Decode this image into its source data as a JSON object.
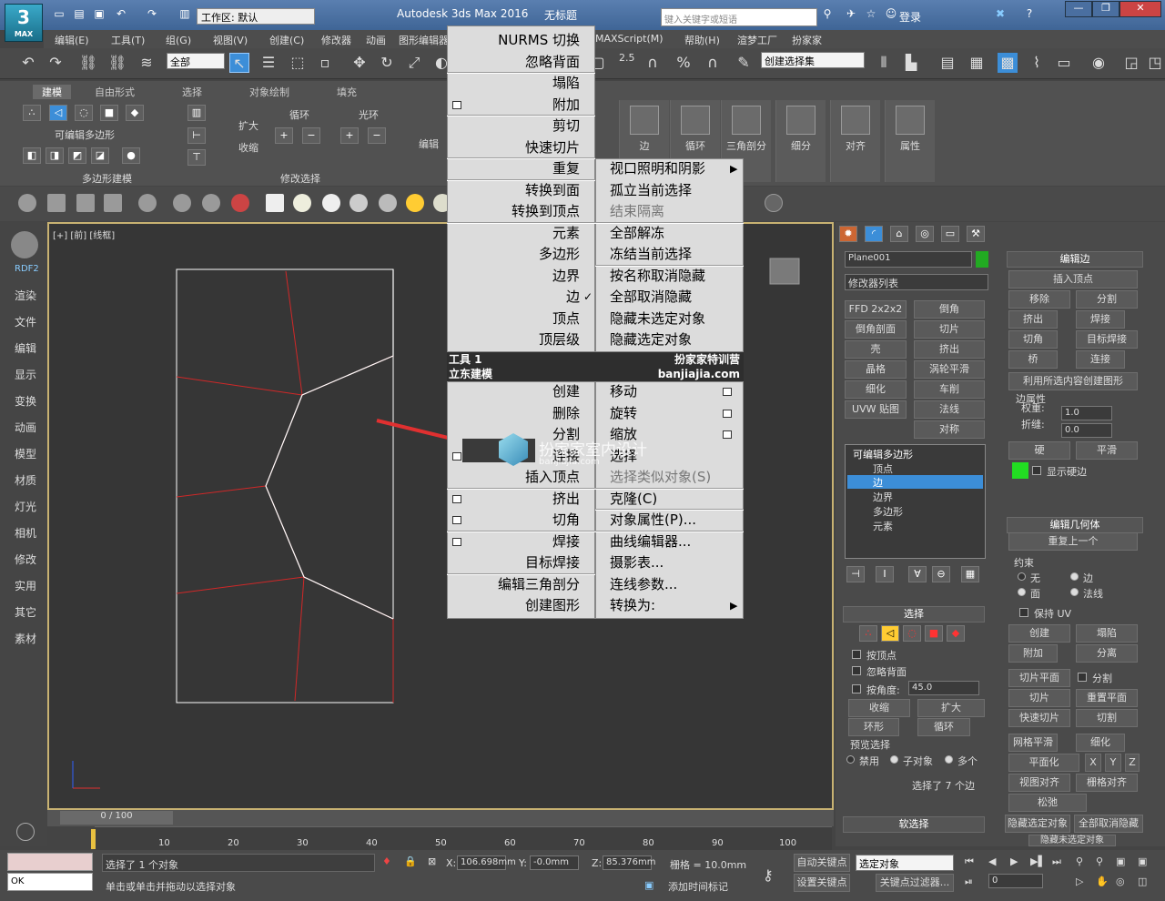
{
  "window": {
    "app_title": "Autodesk 3ds Max 2016",
    "doc_title": "无标题",
    "workspace_label": "工作区: 默认",
    "search_placeholder": "键入关键字或短语",
    "login": "登录",
    "logo_text": "MAX"
  },
  "menu": [
    "编辑(E)",
    "工具(T)",
    "组(G)",
    "视图(V)",
    "创建(C)",
    "修改器",
    "动画",
    "图形编辑器",
    "MAXScript(M)",
    "帮助(H)",
    "渲梦工厂",
    "扮家家"
  ],
  "toolbar1": {
    "filter": "全部",
    "selection_set": "创建选择集",
    "snap_value": "2.5"
  },
  "ribbon": {
    "tabs": [
      "建模",
      "自由形式",
      "选择",
      "对象绘制",
      "填充"
    ],
    "group1_title": "可编辑多边形",
    "group2_title": "多边形建模",
    "grow": "扩大",
    "shrink": "收缩",
    "loop": "循环",
    "ring": "光环",
    "modify_sel": "修改选择",
    "edit": "编辑",
    "big": [
      "边",
      "循环",
      "三角剖分",
      "细分",
      "对齐",
      "属性"
    ]
  },
  "left_bar": [
    "RDF2",
    "渲染",
    "文件",
    "编辑",
    "显示",
    "变换",
    "动画",
    "模型",
    "材质",
    "灯光",
    "相机",
    "修改",
    "实用",
    "其它",
    "素材"
  ],
  "viewport": {
    "label": "[+] [前] [线框]"
  },
  "quad": {
    "left_top": [
      {
        "t": "NURMS 切换"
      },
      {
        "t": "忽略背面"
      },
      {
        "t": "塌陷"
      },
      {
        "t": "附加",
        "box": true
      },
      {
        "t": "剪切"
      },
      {
        "t": "快速切片"
      },
      {
        "t": "重复"
      },
      {
        "t": "转换到面"
      },
      {
        "t": "转换到顶点"
      },
      {
        "t": "元素"
      },
      {
        "t": "多边形"
      },
      {
        "t": "边界"
      },
      {
        "t": "边",
        "check": true
      },
      {
        "t": "顶点"
      },
      {
        "t": "顶层级"
      }
    ],
    "right_top": [
      {
        "t": "视口照明和阴影",
        "arrow": true
      },
      {
        "t": "孤立当前选择"
      },
      {
        "t": "结束隔离",
        "dis": true
      },
      {
        "t": "全部解冻"
      },
      {
        "t": "冻结当前选择"
      },
      {
        "t": "按名称取消隐藏"
      },
      {
        "t": "全部取消隐藏"
      },
      {
        "t": "隐藏未选定对象"
      },
      {
        "t": "隐藏选定对象"
      }
    ],
    "hdr1_left": "工具 1",
    "hdr1_right": "扮家家特训营",
    "hdr2_left": "立东建模",
    "hdr2_right": "banjiajia.com",
    "left_bottom": [
      {
        "t": "创建"
      },
      {
        "t": "删除"
      },
      {
        "t": "分割"
      },
      {
        "t": "连接",
        "box": true
      },
      {
        "t": "插入顶点"
      },
      {
        "t": "挤出",
        "box": true
      },
      {
        "t": "切角",
        "box": true
      },
      {
        "t": "焊接",
        "box": true
      },
      {
        "t": "目标焊接"
      },
      {
        "t": "编辑三角剖分"
      },
      {
        "t": "创建图形"
      }
    ],
    "right_bottom": [
      {
        "t": "移动",
        "box": true
      },
      {
        "t": "旋转",
        "box": true
      },
      {
        "t": "缩放",
        "box": true
      },
      {
        "t": "选择"
      },
      {
        "t": "选择类似对象(S)",
        "dis": true
      },
      {
        "t": "克隆(C)"
      },
      {
        "t": "对象属性(P)..."
      },
      {
        "t": "曲线编辑器..."
      },
      {
        "t": "摄影表..."
      },
      {
        "t": "连线参数..."
      },
      {
        "t": "转换为:",
        "arrow": true
      }
    ]
  },
  "watermark": {
    "line1": "扮家家室内设计",
    "line2": "banjiajia.com"
  },
  "cmd": {
    "object_name": "Plane001",
    "modifier_list": "修改器列表",
    "mod_buttons": [
      "FFD 2x2x2",
      "倒角",
      "倒角剖面",
      "切片",
      "壳",
      "挤出",
      "晶格",
      "涡轮平滑",
      "细化",
      "车削",
      "UVW 贴图",
      "法线",
      "对称"
    ],
    "stack": [
      "可编辑多边形",
      "顶点",
      "边",
      "边界",
      "多边形",
      "元素"
    ],
    "select_title": "选择",
    "by_vertex": "按顶点",
    "ignore_back": "忽略背面",
    "by_angle": "按角度:",
    "angle_val": "45.0",
    "shrink": "收缩",
    "grow": "扩大",
    "ring": "环形",
    "loop": "循环",
    "preview": "预览选择",
    "disable": "禁用",
    "subobj": "子对象",
    "multi": "多个",
    "sel_status": "选择了 7 个边",
    "soft": "软选择",
    "edit_edges": "编辑边",
    "insert_vertex": "插入顶点",
    "remove": "移除",
    "split": "分割",
    "extrude": "挤出",
    "weld": "焊接",
    "chamfer": "切角",
    "target_weld": "目标焊接",
    "bridge": "桥",
    "connect": "连接",
    "create_shape": "利用所选内容创建图形",
    "edge_prop": "边属性",
    "weight": "权重:",
    "weight_val": "1.0",
    "crease": "折缝:",
    "crease_val": "0.0",
    "hard": "硬",
    "smooth": "平滑",
    "show_hard": "显示硬边",
    "edit_geom": "编辑几何体",
    "repeat": "重复上一个",
    "constraint": "约束",
    "none": "无",
    "edge": "边",
    "face": "面",
    "normal": "法线",
    "keep_uv": "保持 UV",
    "create": "创建",
    "collapse": "塌陷",
    "attach": "附加",
    "detach": "分离",
    "slice_plane": "切片平面",
    "split2": "分割",
    "slice": "切片",
    "reset_plane": "重置平面",
    "quick_slice": "快速切片",
    "cut": "切割",
    "mesh_smooth": "网格平滑",
    "tessellate": "细化",
    "planar": "平面化",
    "x": "X",
    "y": "Y",
    "z": "Z",
    "view_align": "视图对齐",
    "grid_align": "栅格对齐",
    "relax": "松弛",
    "hide_sel": "隐藏选定对象",
    "unhide_all": "全部取消隐藏",
    "hide_unsel": "隐藏未选定对象"
  },
  "timeline": {
    "frame": "0 / 100",
    "ticks": [
      "10",
      "20",
      "30",
      "40",
      "50",
      "60",
      "70",
      "80",
      "90",
      "100"
    ]
  },
  "status": {
    "sel": "选择了 1 个对象",
    "prompt": "单击或单击并拖动以选择对象",
    "x": "106.698mm",
    "y": "-0.0mm",
    "z": "85.376mm",
    "grid": "栅格 = 10.0mm",
    "auto_key": "自动关键点",
    "set_key": "设置关键点",
    "sel_obj": "选定对象",
    "key_filter": "关键点过滤器...",
    "add_time": "添加时间标记",
    "frame_val": "0",
    "ok": "OK"
  },
  "colors": {
    "accent": "#3c8ed8",
    "wire_red": "#d02828",
    "wire_white": "#ffffff",
    "green": "#22dd22"
  }
}
